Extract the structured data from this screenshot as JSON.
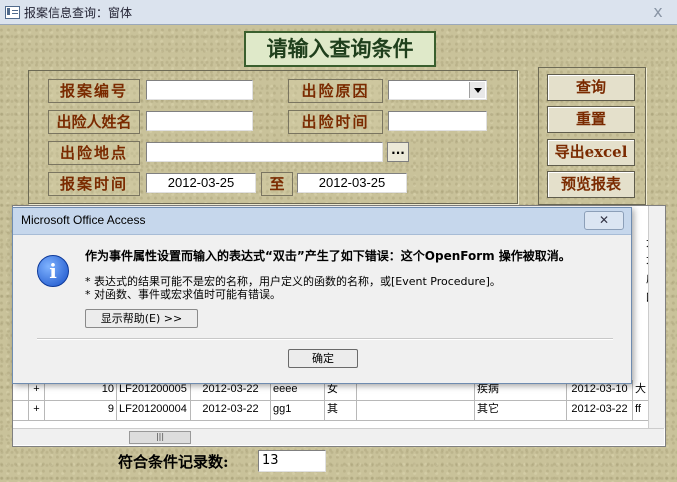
{
  "window": {
    "title": "报案信息查询：窗体",
    "close_glyph": "x"
  },
  "heading": "请输入查询条件",
  "form": {
    "report_no_label": "报案编号",
    "reason_label": "出险原因",
    "person_label": "出险人姓名",
    "accident_time_label": "出险时间",
    "location_label": "出险地点",
    "browse_label": "...",
    "report_time_label": "报案时间",
    "date_from": "2012-03-25",
    "to_label": "至",
    "date_to": "2012-03-25"
  },
  "buttons": {
    "query": "查询",
    "reset": "重置",
    "export": "导出excel",
    "preview": "预览报表"
  },
  "grid": {
    "rows": [
      {
        "expand": "+",
        "id": "10",
        "code": "LF201200005",
        "date": "2012-03-22",
        "name": "eeee",
        "gender": "女",
        "extra": "",
        "reason": "疾病",
        "date2": "2012-03-10",
        "tail": "大"
      },
      {
        "expand": "+",
        "id": "9",
        "code": "LF201200004",
        "date": "2012-03-22",
        "name": "gg1",
        "gender": "其",
        "extra": "",
        "reason": "其它",
        "date2": "2012-03-22",
        "tail": "ff"
      }
    ],
    "right_col": [
      "大",
      "大",
      "成",
      "四"
    ],
    "scroll_thumb": "|||"
  },
  "record_count": {
    "label": "符合条件记录数:",
    "value": "13"
  },
  "dialog": {
    "title": "Microsoft Office Access",
    "close": "✕",
    "icon": "i",
    "main": "作为事件属性设置而输入的表达式“双击”产生了如下错误：这个OpenForm 操作被取消。",
    "line1": "* 表达式的结果可能不是宏的名称，用户定义的函数的名称，或[Event Procedure]。",
    "line2": "* 对函数、事件或宏求值时可能有错误。",
    "help": "显示帮助(E) >>",
    "ok": "确定"
  }
}
